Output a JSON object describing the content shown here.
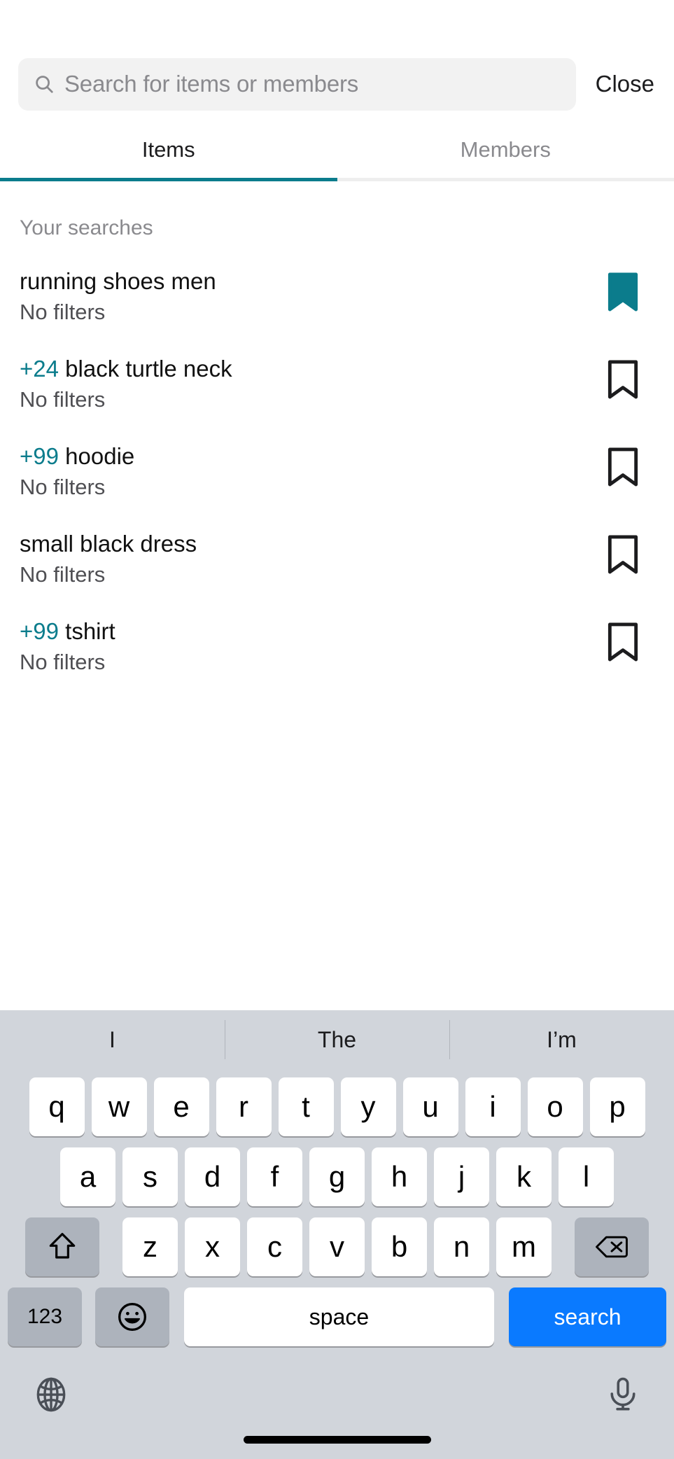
{
  "colors": {
    "accent_teal": "#0b7c8c",
    "keyboard_bg": "#d1d5db",
    "key_white": "#ffffff",
    "key_gray": "#adb3bc",
    "search_blue": "#0a7aff",
    "search_field_bg": "#f2f2f2"
  },
  "header": {
    "search_placeholder": "Search for items or members",
    "search_value": "",
    "close_label": "Close",
    "search_icon": "search-icon"
  },
  "tabs": {
    "items": [
      {
        "label": "Items",
        "active": true
      },
      {
        "label": "Members",
        "active": false
      }
    ]
  },
  "results": {
    "section_label": "Your searches",
    "rows": [
      {
        "count": "",
        "title": "running shoes men",
        "subtitle": "No filters",
        "bookmark": "bookmark-filled-icon",
        "bookmarked": true
      },
      {
        "count": "+24",
        "title": "black turtle neck",
        "subtitle": "No filters",
        "bookmark": "bookmark-outline-icon",
        "bookmarked": false
      },
      {
        "count": "+99",
        "title": "hoodie",
        "subtitle": "No filters",
        "bookmark": "bookmark-outline-icon",
        "bookmarked": false
      },
      {
        "count": "",
        "title": "small black dress",
        "subtitle": "No filters",
        "bookmark": "bookmark-outline-icon",
        "bookmarked": false
      },
      {
        "count": "+99",
        "title": "tshirt",
        "subtitle": "No filters",
        "bookmark": "bookmark-outline-icon",
        "bookmarked": false
      }
    ]
  },
  "keyboard": {
    "suggestions": [
      "I",
      "The",
      "I’m"
    ],
    "row1": [
      "q",
      "w",
      "e",
      "r",
      "t",
      "y",
      "u",
      "i",
      "o",
      "p"
    ],
    "row2": [
      "a",
      "s",
      "d",
      "f",
      "g",
      "h",
      "j",
      "k",
      "l"
    ],
    "row3": [
      "z",
      "x",
      "c",
      "v",
      "b",
      "n",
      "m"
    ],
    "shift_icon": "shift-arrow-icon",
    "backspace_icon": "backspace-icon",
    "numbers_label": "123",
    "emoji_icon": "emoji-smiley-icon",
    "space_label": "space",
    "search_label": "search",
    "globe_icon": "globe-icon",
    "mic_icon": "microphone-icon"
  }
}
